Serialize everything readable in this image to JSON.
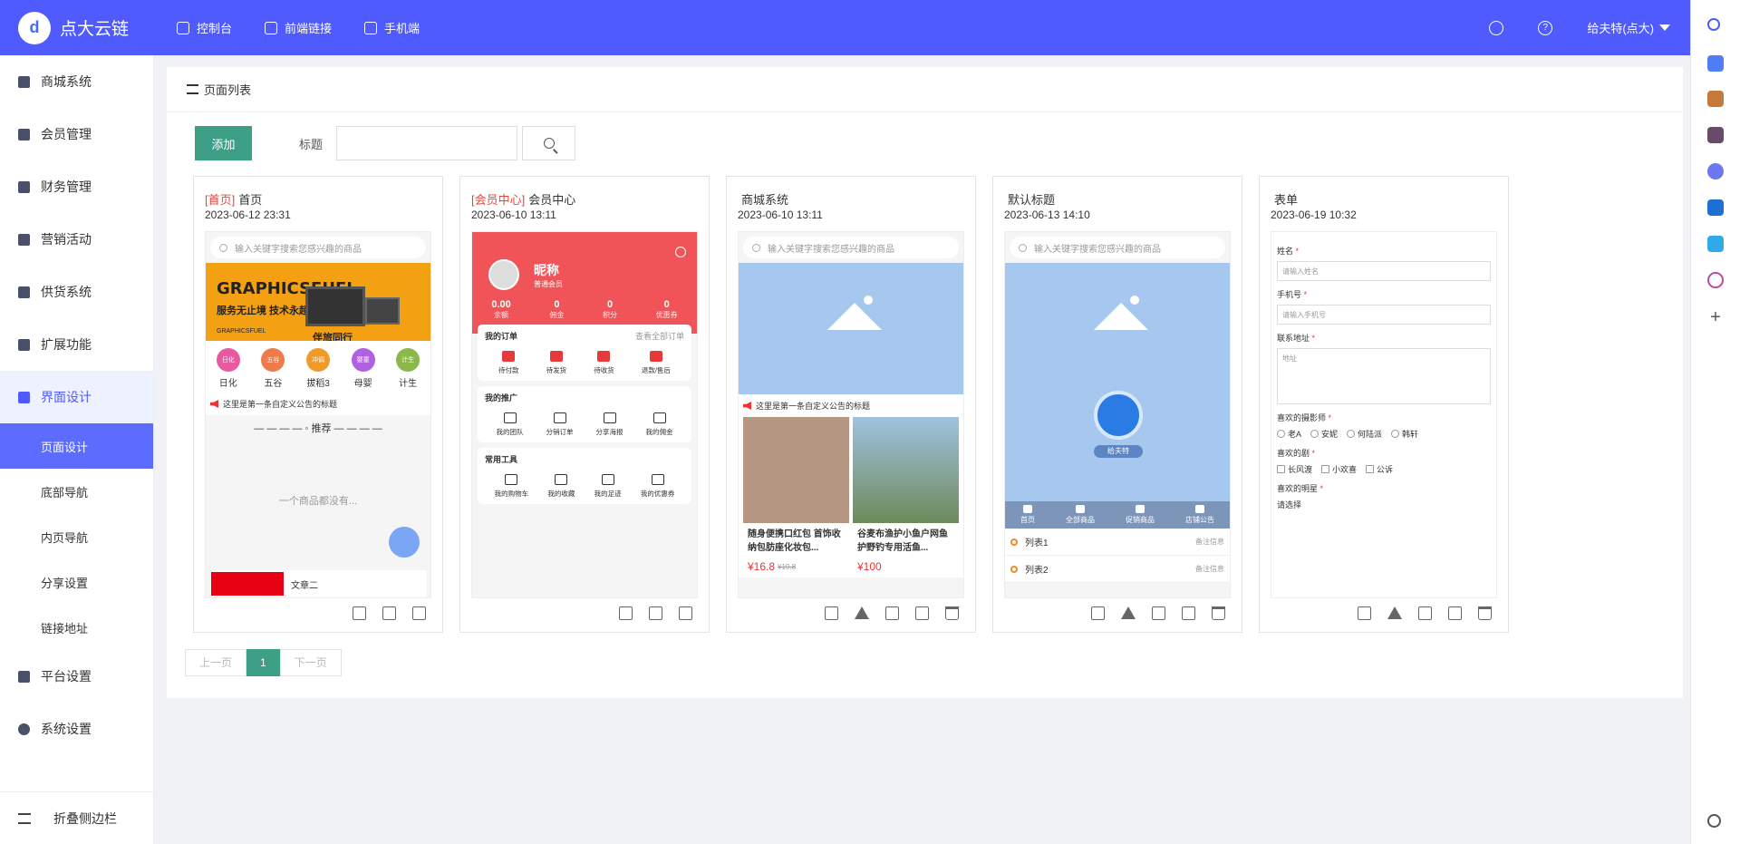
{
  "header": {
    "brand": "点大云链",
    "nav": [
      "控制台",
      "前端链接",
      "手机端"
    ],
    "user": "给夫特(点大)"
  },
  "sidebar": {
    "items": [
      {
        "label": "商城系统"
      },
      {
        "label": "会员管理"
      },
      {
        "label": "财务管理"
      },
      {
        "label": "营销活动"
      },
      {
        "label": "供货系统"
      },
      {
        "label": "扩展功能"
      },
      {
        "label": "界面设计"
      }
    ],
    "sub_items": [
      "页面设计",
      "底部导航",
      "内页导航",
      "分享设置",
      "链接地址"
    ],
    "bottom_items": [
      {
        "label": "平台设置"
      },
      {
        "label": "系统设置"
      }
    ],
    "collapse_label": "折叠侧边栏"
  },
  "panel": {
    "title": "页面列表",
    "add_label": "添加",
    "filter_label": "标题",
    "filter_value": ""
  },
  "cards": [
    {
      "tag": "[首页]",
      "title": "首页",
      "date": "2023-06-12 23:31"
    },
    {
      "tag": "[会员中心]",
      "title": "会员中心",
      "date": "2023-06-10 13:11"
    },
    {
      "tag": "",
      "title": "商城系统",
      "date": "2023-06-10 13:11"
    },
    {
      "tag": "",
      "title": "默认标题",
      "date": "2023-06-13 14:10"
    },
    {
      "tag": "",
      "title": "表单",
      "date": "2023-06-19 10:32"
    }
  ],
  "preview_home": {
    "search_placeholder": "输入关键字搜索您感兴趣的商品",
    "banner_text1": "GRAPHICSFUEL",
    "banner_text2": "服务无止境 技术永超越",
    "banner_text3": "GRAPHICSFUEL",
    "banner_text4": "伴旅同行",
    "categories": [
      {
        "label": "日化",
        "icon": "日化",
        "color": "#e75aa0"
      },
      {
        "label": "五谷",
        "icon": "五谷",
        "color": "#f07b4a"
      },
      {
        "label": "拔稻3",
        "icon": "冲调",
        "color": "#f09a2a"
      },
      {
        "label": "母婴",
        "icon": "婴童",
        "color": "#b061e0"
      },
      {
        "label": "计生",
        "icon": "计生",
        "color": "#8bb84a"
      }
    ],
    "notice": "这里是第一条自定义公告的标题",
    "recommend": "推荐",
    "empty": "一个商品都没有...",
    "article_title": "文章二"
  },
  "preview_member": {
    "nickname": "昵称",
    "level": "普通会员",
    "stats": [
      {
        "value": "0.00",
        "label": "余额"
      },
      {
        "value": "0",
        "label": "佣金"
      },
      {
        "value": "0",
        "label": "积分"
      },
      {
        "value": "0",
        "label": "优惠券"
      }
    ],
    "orders_title": "我的订单",
    "orders_more": "查看全部订单",
    "orders": [
      "待付款",
      "待发货",
      "待收货",
      "退款/售后"
    ],
    "promo_title": "我的推广",
    "promo": [
      "我的团队",
      "分销订单",
      "分享海报",
      "我的佣金"
    ],
    "tools_title": "常用工具",
    "tools": [
      "我的购物车",
      "我的收藏",
      "我的足迹",
      "我的优惠券"
    ]
  },
  "preview_shop": {
    "search_placeholder": "输入关键字搜索您感兴趣的商品",
    "notice": "这里是第一条自定义公告的标题",
    "products": [
      {
        "title": "随身便携口红包 首饰收纳包肪座化妆包...",
        "price": "¥16.8",
        "old_price": "¥19.8"
      },
      {
        "title": "谷麦布渔护小鱼户网鱼护野钓专用活鱼...",
        "price": "¥100",
        "old_price": ""
      }
    ]
  },
  "preview_default": {
    "search_placeholder": "输入关键字搜索您感兴趣的商品",
    "brand_name": "给夫特",
    "tabs": [
      "首页",
      "全部商品",
      "促销商品",
      "店铺公告"
    ],
    "list": [
      {
        "label": "列表1",
        "note": "备注信息"
      },
      {
        "label": "列表2",
        "note": "备注信息"
      }
    ]
  },
  "preview_form": {
    "fields": [
      {
        "label": "姓名",
        "placeholder": "请输入姓名"
      },
      {
        "label": "手机号",
        "placeholder": "请输入手机号"
      },
      {
        "label": "联系地址",
        "placeholder": "地址"
      }
    ],
    "radio_label": "喜欢的摄影师",
    "radios": [
      "老A",
      "安妮",
      "何陆派",
      "韩轩"
    ],
    "check_label": "喜欢的剧",
    "checks": [
      "长风渡",
      "小欢喜",
      "公诉"
    ],
    "select_label": "喜欢的明星",
    "select_value": "请选择"
  },
  "pager": {
    "prev": "上一页",
    "current": "1",
    "next": "下一页"
  },
  "colors": {
    "accent": "#4f5bff",
    "primary_button": "#3e9f87",
    "tag": "#e0483e"
  }
}
